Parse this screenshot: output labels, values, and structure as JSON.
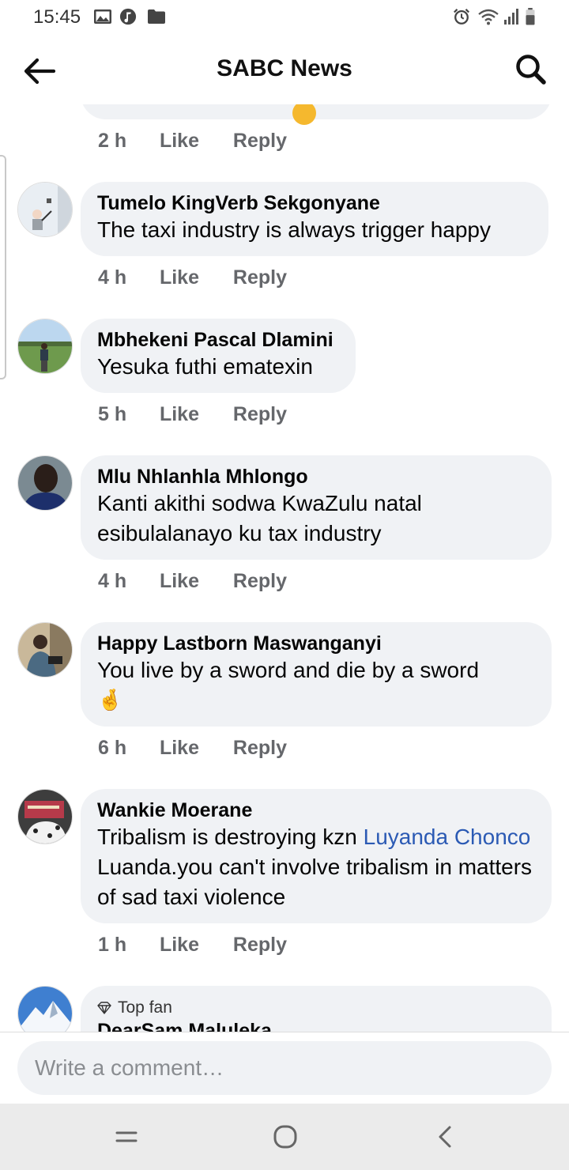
{
  "status_bar": {
    "time": "15:45",
    "left_icons": [
      "image-icon",
      "music-icon",
      "folder-icon"
    ],
    "right_icons": [
      "alarm-icon",
      "wifi-icon",
      "signal-icon",
      "battery-icon"
    ]
  },
  "header": {
    "title": "SABC News",
    "back_icon": "arrow-left-icon",
    "search_icon": "search-icon"
  },
  "previous_comment": {
    "time": "2 h",
    "like": "Like",
    "reply": "Reply"
  },
  "comments": [
    {
      "author": "Tumelo KingVerb Sekgonyane",
      "text": "The taxi industry is always trigger happy",
      "time": "4 h",
      "like": "Like",
      "reply": "Reply"
    },
    {
      "author": "Mbhekeni Pascal Dlamini",
      "text": "Yesuka futhi ematexin",
      "time": "5 h",
      "like": "Like",
      "reply": "Reply"
    },
    {
      "author": "Mlu Nhlanhla Mhlongo",
      "text_line1": "Kanti akithi sodwa KwaZulu natal",
      "text_line2": "esibulalanayo ku tax industry",
      "time": "4 h",
      "like": "Like",
      "reply": "Reply"
    },
    {
      "author": "Happy Lastborn Maswanganyi",
      "text": "You live by a sword and die by a sword",
      "emoji": "🤞",
      "time": "6 h",
      "like": "Like",
      "reply": "Reply"
    },
    {
      "author": "Wankie Moerane",
      "text_before": "Tribalism is destroying kzn ",
      "mention": "Luyanda Chonco",
      "text_after": " Luanda.you can't involve tribalism in matters of sad taxi violence",
      "time": "1 h",
      "like": "Like",
      "reply": "Reply"
    },
    {
      "badge": "Top fan",
      "author": "DearSam Maluleka"
    }
  ],
  "composer": {
    "placeholder": "Write a comment…"
  },
  "nav_bar": {
    "icons": [
      "recent-apps-icon",
      "home-icon",
      "back-icon"
    ]
  },
  "colors": {
    "bubble": "#f0f2f5",
    "action_text": "#65676b",
    "mention": "#2b5ab4"
  }
}
